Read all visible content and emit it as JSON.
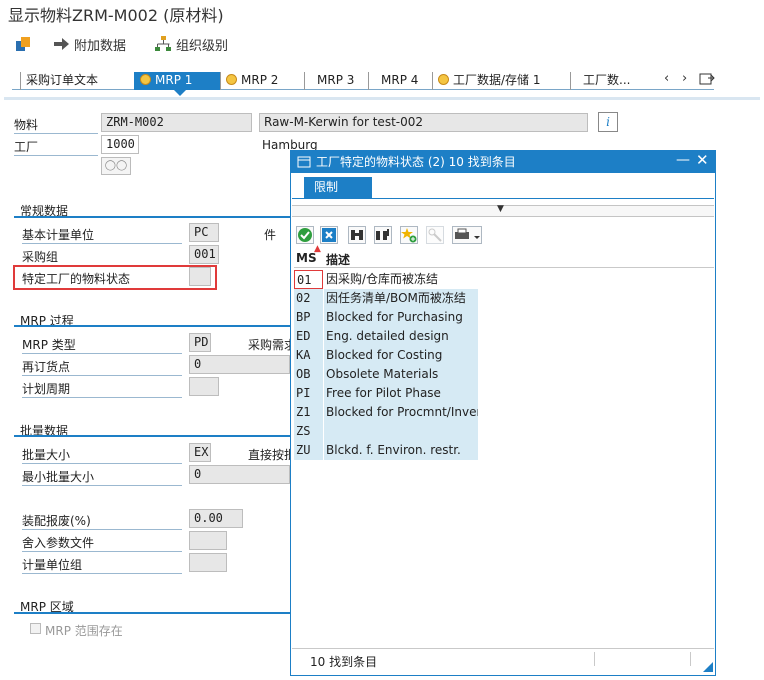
{
  "app": {
    "title": "显示物料ZRM-M002 (原材料)"
  },
  "toolbar": {
    "additional_data": "附加数据",
    "org_levels": "组织级别"
  },
  "tabs": [
    {
      "label": "采购订单文本"
    },
    {
      "label": "MRP 1"
    },
    {
      "label": "MRP 2"
    },
    {
      "label": "MRP 3"
    },
    {
      "label": "MRP 4"
    },
    {
      "label": "工厂数据/存储 1"
    },
    {
      "label": "工厂数..."
    }
  ],
  "header": {
    "material_label": "物料",
    "material_value": "ZRM-M002",
    "material_desc": "Raw-M-Kerwin for test-002",
    "plant_label": "工厂",
    "plant_value": "1000",
    "plant_name": "Hamburg"
  },
  "general": {
    "title": "常规数据",
    "base_uom_label": "基本计量单位",
    "base_uom_value": "PC",
    "base_uom_unit": "件",
    "purch_group_label": "采购组",
    "purch_group_value": "001",
    "plant_status_label": "特定工厂的物料状态",
    "plant_status_value": ""
  },
  "mrp_proc": {
    "title": "MRP 过程",
    "mrp_type_label": "MRP 类型",
    "mrp_type_value": "PD",
    "mrp_type_desc": "采购需求",
    "reorder_label": "再订货点",
    "reorder_value": "0",
    "cycle_label": "计划周期"
  },
  "lot": {
    "title": "批量数据",
    "lot_size_label": "批量大小",
    "lot_size_value": "EX",
    "lot_size_desc": "直接按批",
    "min_lot_label": "最小批量大小",
    "min_lot_value": "0",
    "scrap_label": "装配报废(%)",
    "scrap_value": "0.00",
    "rounding_label": "舍入参数文件",
    "uom_group_label": "计量单位组"
  },
  "mrp_area": {
    "title": "MRP 区域",
    "checkbox_label": "MRP  范围存在"
  },
  "popup": {
    "title": "工厂特定的物料状态 (2)   10 找到条目",
    "restrict_tab": "限制",
    "col_code": "MS",
    "col_desc": "描述",
    "rows": [
      {
        "code": "01",
        "desc": "因采购/仓库而被冻结"
      },
      {
        "code": "02",
        "desc": "因任务清单/BOM而被冻结"
      },
      {
        "code": "BP",
        "desc": "Blocked for Purchasing"
      },
      {
        "code": "ED",
        "desc": "Eng. detailed design"
      },
      {
        "code": "KA",
        "desc": "Blocked for Costing"
      },
      {
        "code": "OB",
        "desc": "Obsolete Materials"
      },
      {
        "code": "PI",
        "desc": "Free for Pilot Phase"
      },
      {
        "code": "Z1",
        "desc": "Blocked for Procmnt/Inven"
      },
      {
        "code": "ZS",
        "desc": ""
      },
      {
        "code": "ZU",
        "desc": "Blckd. f. Environ. restr."
      }
    ],
    "status": "10 找到条目"
  },
  "colors": {
    "accent": "#1d7fc6",
    "highlight": "#e03a3a",
    "row_bg": "#d6eaf4"
  }
}
